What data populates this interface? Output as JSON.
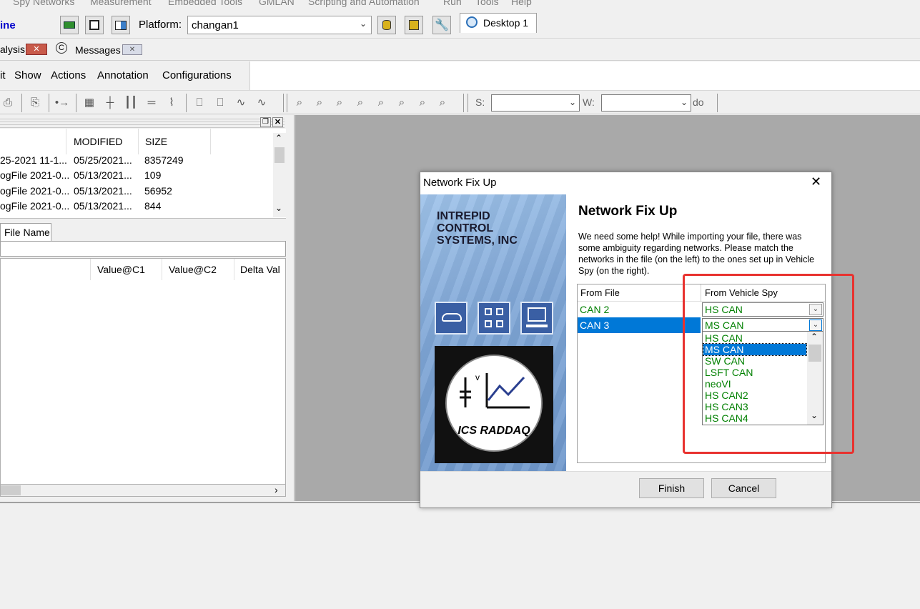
{
  "menubar": {
    "items": [
      "Spy Networks",
      "Measurement",
      "Embedded Tools",
      "GMLAN",
      "Scripting and Automation",
      "Run",
      "Tools",
      "Help"
    ]
  },
  "toolbar1": {
    "left_label": "ine",
    "platform_label": "Platform:",
    "platform_value": "changan1",
    "desktop_tab": "Desktop 1"
  },
  "tabstrip2": {
    "analysis_tab": "alysis",
    "messages_tab": "Messages"
  },
  "menu3": {
    "items": [
      "it",
      "Show",
      "Actions",
      "Annotation",
      "Configurations"
    ]
  },
  "toolbar4": {
    "s_label": "S:",
    "w_label": "W:",
    "do_label": "do"
  },
  "filelist": {
    "headers": [
      "MODIFIED",
      "SIZE"
    ],
    "rows": [
      {
        "name": "25-2021 11-1...",
        "modified": "05/25/2021...",
        "size": "8357249"
      },
      {
        "name": "ogFile 2021-0...",
        "modified": "05/13/2021...",
        "size": "109"
      },
      {
        "name": "ogFile 2021-0...",
        "modified": "05/13/2021...",
        "size": "56952"
      },
      {
        "name": "ogFile 2021-0...",
        "modified": "05/13/2021...",
        "size": "844"
      }
    ]
  },
  "lower_panel": {
    "tab_label": "File Name",
    "headers": [
      "Value@C1",
      "Value@C2",
      "Delta Val"
    ]
  },
  "dialog": {
    "title": "Network Fix Up",
    "heading": "Network Fix Up",
    "description": "We need some help! While importing your file, there was some ambiguity regarding networks. Please match the networks in the file (on the left) to the ones set up in Vehicle Spy (on the right).",
    "brand_text": "INTREPID CONTROL SYSTEMS, INC",
    "logo_text": "ICS RADDAQ",
    "grid_headers": [
      "From File",
      "From Vehicle Spy"
    ],
    "rows": [
      {
        "from_file": "CAN 2",
        "from_spy": "HS CAN"
      },
      {
        "from_file": "CAN 3",
        "from_spy": "MS CAN"
      }
    ],
    "dropdown_options": [
      "HS CAN",
      "MS CAN",
      "SW CAN",
      "LSFT CAN",
      "neoVI",
      "HS CAN2",
      "HS CAN3",
      "HS CAN4"
    ],
    "dropdown_selected": "MS CAN",
    "finish_label": "Finish",
    "cancel_label": "Cancel"
  },
  "colors": {
    "highlight": "#0078d7",
    "network_text": "#008000",
    "annotation_box": "#e8322f",
    "workspace": "#a9a9a9"
  }
}
